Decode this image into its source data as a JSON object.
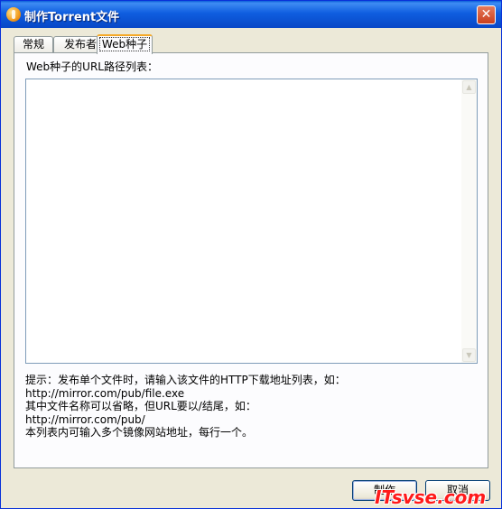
{
  "window": {
    "title": "制作Torrent文件",
    "close_glyph": "✕"
  },
  "tabs": [
    {
      "label": "常规",
      "active": false
    },
    {
      "label": "发布者",
      "active": false
    },
    {
      "label": "Web种子",
      "active": true
    }
  ],
  "web_seed": {
    "list_label": "Web种子的URL路径列表：",
    "list_value": "",
    "hint_lines": [
      "提示：发布单个文件时，请输入该文件的HTTP下载地址列表，如：",
      "http://mirror.com/pub/file.exe",
      "其中文件名称可以省略，但URL要以/结尾，如：",
      "http://mirror.com/pub/",
      "本列表内可输入多个镜像网站地址，每行一个。"
    ]
  },
  "buttons": {
    "ok_label": "制作",
    "cancel_label": "取消"
  },
  "watermark": "ITsvse.com",
  "icons": {
    "app": "utorrent-icon",
    "close": "close-icon",
    "scroll_up": "scroll-up-arrow-icon",
    "scroll_down": "scroll-down-arrow-icon"
  },
  "colors": {
    "titlebar": "#0a5fd8",
    "dialog_bg": "#ece9d8",
    "active_tab_highlight": "#f5a927",
    "watermark": "#ff1a1a"
  }
}
